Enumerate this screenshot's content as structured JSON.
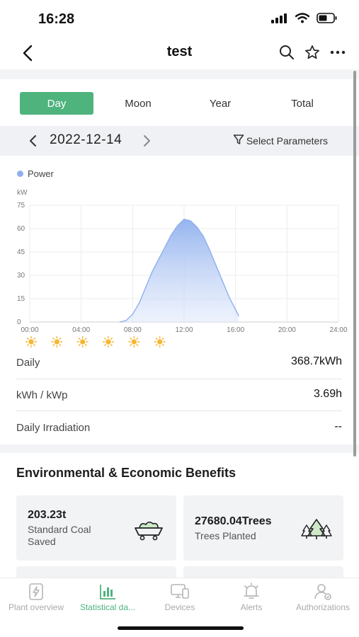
{
  "status_bar": {
    "time": "16:28"
  },
  "nav": {
    "title": "test"
  },
  "period_tabs": [
    {
      "label": "Day",
      "active": true
    },
    {
      "label": "Moon",
      "active": false
    },
    {
      "label": "Year",
      "active": false
    },
    {
      "label": "Total",
      "active": false
    }
  ],
  "date_nav": {
    "date": "2022-12-14",
    "select_parameters": "Select Parameters"
  },
  "chart_data": {
    "type": "area",
    "legend": [
      "Power"
    ],
    "ylabel": "kW",
    "ylim": [
      0,
      75
    ],
    "yticks": [
      "0",
      "15",
      "30",
      "45",
      "60",
      "75"
    ],
    "xticks": [
      "00:00",
      "04:00",
      "08:00",
      "12:00",
      "16:00",
      "20:00",
      "24:00"
    ],
    "grid": true,
    "series": [
      {
        "name": "Power",
        "color": "#8fb0ee",
        "x": [
          "07:00",
          "07:30",
          "08:00",
          "08:30",
          "09:00",
          "09:30",
          "10:00",
          "10:30",
          "11:00",
          "11:30",
          "12:00",
          "12:30",
          "13:00",
          "13:30",
          "14:00",
          "14:30",
          "15:00",
          "15:30",
          "16:00",
          "16:15"
        ],
        "values": [
          0,
          1,
          5,
          12,
          22,
          32,
          40,
          48,
          56,
          62,
          66,
          65,
          61,
          55,
          46,
          36,
          26,
          16,
          8,
          4
        ]
      }
    ],
    "weather_icons": [
      "sun-icon",
      "sun-icon",
      "sun-icon",
      "sun-icon",
      "sun-icon",
      "sun-icon"
    ]
  },
  "metrics": [
    {
      "label": "Daily",
      "value": "368.7kWh"
    },
    {
      "label": "kWh / kWp",
      "value": "3.69h"
    },
    {
      "label": "Daily Irradiation",
      "value": "--"
    }
  ],
  "benefits": {
    "title": "Environmental & Economic Benefits",
    "cards": [
      {
        "value": "203.23t",
        "label": "Standard Coal Saved",
        "icon": "coal-cart-icon"
      },
      {
        "value": "27680.04Trees",
        "label": "Trees Planted",
        "icon": "trees-icon"
      }
    ]
  },
  "tab_bar": [
    {
      "label": "Plant overview",
      "icon": "plant-overview-icon",
      "active": false
    },
    {
      "label": "Statistical da...",
      "icon": "statistics-icon",
      "active": true
    },
    {
      "label": "Devices",
      "icon": "devices-icon",
      "active": false
    },
    {
      "label": "Alerts",
      "icon": "alerts-icon",
      "active": false
    },
    {
      "label": "Authorizations",
      "icon": "authorizations-icon",
      "active": false
    }
  ],
  "colors": {
    "accent": "#4fb37e",
    "chart_fill": "#8fb0ee"
  }
}
